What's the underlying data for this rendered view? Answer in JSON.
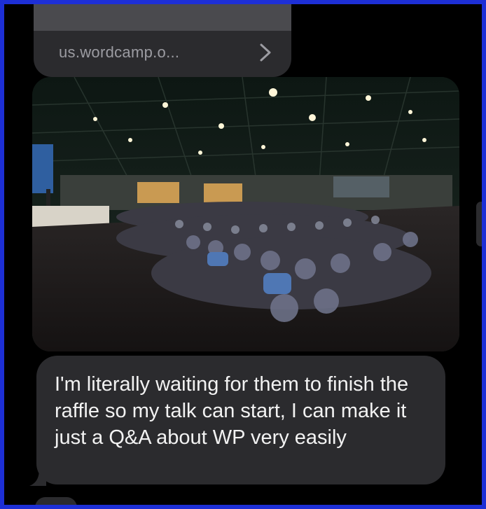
{
  "link_preview": {
    "domain": "us.wordcamp.o...",
    "chevron_icon": "chevron-right-icon"
  },
  "photo": {
    "description_icon": "image"
  },
  "message": {
    "text": "I'm literally waiting for them to finish the raffle so my talk can start, I can make it just a Q&A about WP very easily"
  },
  "colors": {
    "frame_border": "#1d2fd6",
    "background": "#000000",
    "bubble": "#2b2b2e",
    "text": "#f2f2f2",
    "link_text": "#9c9ca2"
  }
}
